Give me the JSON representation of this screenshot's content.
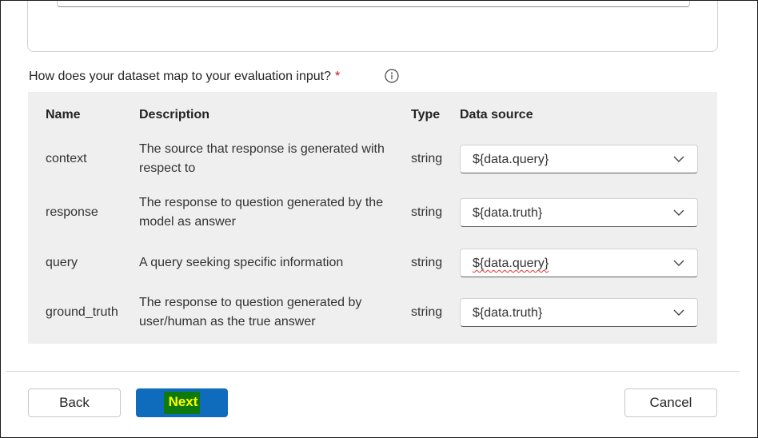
{
  "mapping": {
    "question": "How does your dataset map to your evaluation input?",
    "required_marker": "*",
    "columns": {
      "name": "Name",
      "description": "Description",
      "type": "Type",
      "source": "Data source"
    },
    "rows": [
      {
        "name": "context",
        "description": "The source that response is generated with respect to",
        "type": "string",
        "source": "${data.query}"
      },
      {
        "name": "response",
        "description": "The response to question generated by the model as answer",
        "type": "string",
        "source": "${data.truth}"
      },
      {
        "name": "query",
        "description": "A query seeking specific information",
        "type": "string",
        "source": "${data.query}"
      },
      {
        "name": "ground_truth",
        "description": "The response to question generated by user/human as the true answer",
        "type": "string",
        "source": "${data.truth}"
      }
    ]
  },
  "footer": {
    "back_label": "Back",
    "next_label": "Next",
    "cancel_label": "Cancel"
  },
  "colors": {
    "primary": "#0f6cbd",
    "highlight_bg": "#0e7a0d",
    "highlight_text": "#ffff00",
    "required": "#c50f1f",
    "table_bg": "#efefef"
  },
  "icons": {
    "info": "info-icon",
    "dropdown": "chevron-down-icon"
  }
}
